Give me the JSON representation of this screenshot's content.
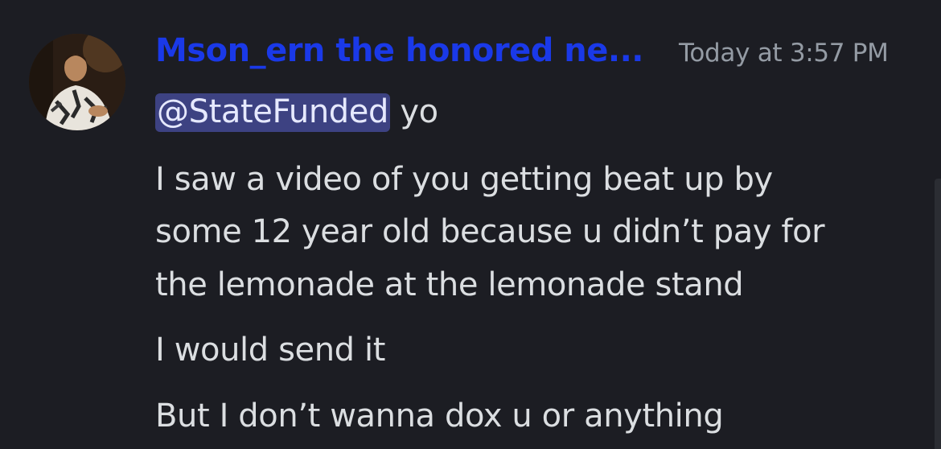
{
  "message": {
    "author": "Mson_ern the honored ne...",
    "timestamp": "Today at 3:57 PM",
    "mention": "@StateFunded",
    "first_line_text": "yo",
    "lines": [
      "I saw a video of you getting beat up by",
      "some 12 year old because u didn’t pay for",
      "the lemonade at the lemonade stand",
      "I would send it",
      "But I don’t wanna dox u or anything"
    ]
  },
  "colors": {
    "background": "#1c1d23",
    "username": "#1a39e8",
    "mention_bg": "#3d4282",
    "timestamp": "#949ba4",
    "text": "#dbdee1"
  },
  "icons": {
    "avatar": "user-avatar-photo"
  }
}
